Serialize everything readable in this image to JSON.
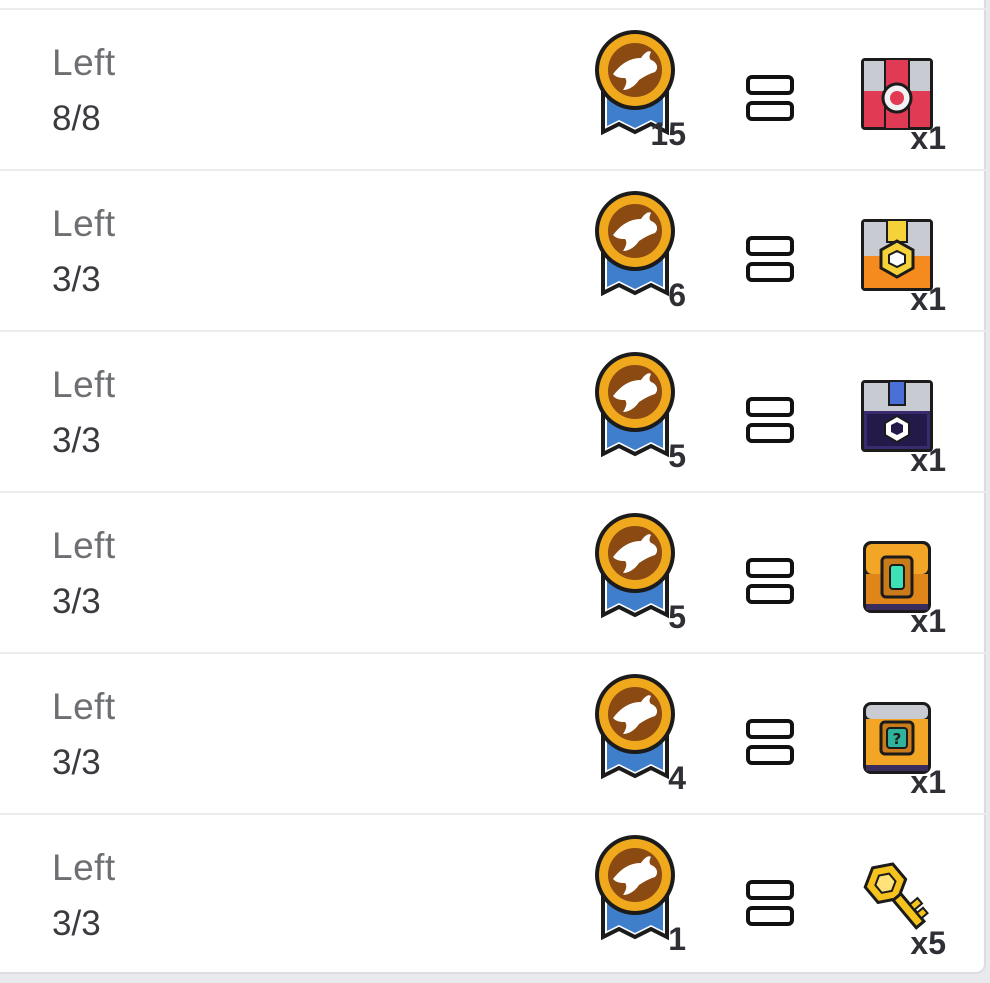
{
  "exchange_rows": [
    {
      "left_label": "Left",
      "left_count": "8/8",
      "medal_qty": "15",
      "reward_icon": "red-chest-icon",
      "reward_qty": "x1"
    },
    {
      "left_label": "Left",
      "left_count": "3/3",
      "medal_qty": "6",
      "reward_icon": "orange-gold-chest-icon",
      "reward_qty": "x1"
    },
    {
      "left_label": "Left",
      "left_count": "3/3",
      "medal_qty": "5",
      "reward_icon": "purple-chest-icon",
      "reward_qty": "x1"
    },
    {
      "left_label": "Left",
      "left_count": "3/3",
      "medal_qty": "5",
      "reward_icon": "green-gem-chest-icon",
      "reward_qty": "x1"
    },
    {
      "left_label": "Left",
      "left_count": "3/3",
      "medal_qty": "4",
      "reward_icon": "mystery-chest-icon",
      "reward_qty": "x1"
    },
    {
      "left_label": "Left",
      "left_count": "3/3",
      "medal_qty": "1",
      "reward_icon": "golden-key-icon",
      "reward_qty": "x5"
    }
  ],
  "icons": {
    "medal": "shark-medal-icon",
    "equals": "equals-icon"
  },
  "colors": {
    "text_muted": "#6e6f73",
    "text_dark": "#2f3036",
    "medal_gold": "#f0a81c",
    "medal_brown": "#8a4a12",
    "ribbon_blue": "#3f7ecb"
  }
}
